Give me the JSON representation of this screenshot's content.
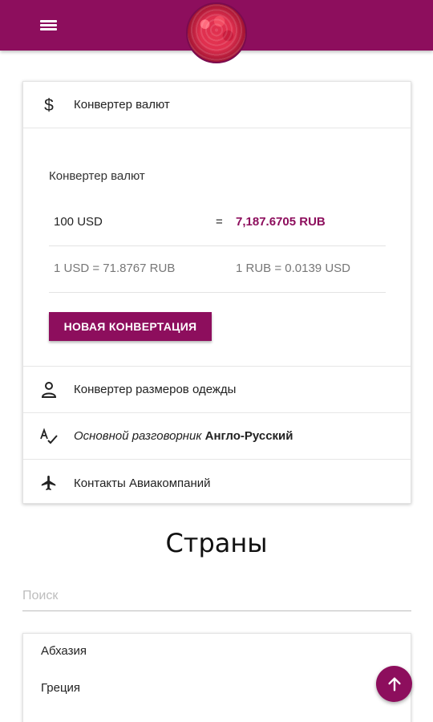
{
  "header": {
    "menu_icon": "hamburger-icon",
    "avatar_image": "raspberry-photo"
  },
  "card": {
    "currency_row": {
      "icon": "dollar-icon",
      "label": "Конвертер валют"
    },
    "converter": {
      "title": "Конвертер валют",
      "from_value": "100 USD",
      "equals": "=",
      "result": "7,187.6705 RUB",
      "rate_forward": "1 USD = 71.8767 RUB",
      "rate_reverse": "1 RUB = 0.0139 USD",
      "new_button_label": "НОВАЯ КОНВЕРТАЦИЯ"
    },
    "clothing_row": {
      "icon": "person-icon",
      "label": "Конвертер размеров одежды"
    },
    "phrasebook_row": {
      "icon": "spellcheck-icon",
      "label_italic": "Основной разговорник",
      "label_bold": "Англо-Русский"
    },
    "airlines_row": {
      "icon": "airplane-icon",
      "label": "Контакты Авиакомпаний"
    }
  },
  "countries": {
    "title": "Страны",
    "search_placeholder": "Поиск",
    "search_value": "",
    "items": [
      "Абхазия",
      "Греция"
    ]
  },
  "fab": {
    "icon": "arrow-up-icon"
  },
  "colors": {
    "accent": "#8d0e5d"
  }
}
